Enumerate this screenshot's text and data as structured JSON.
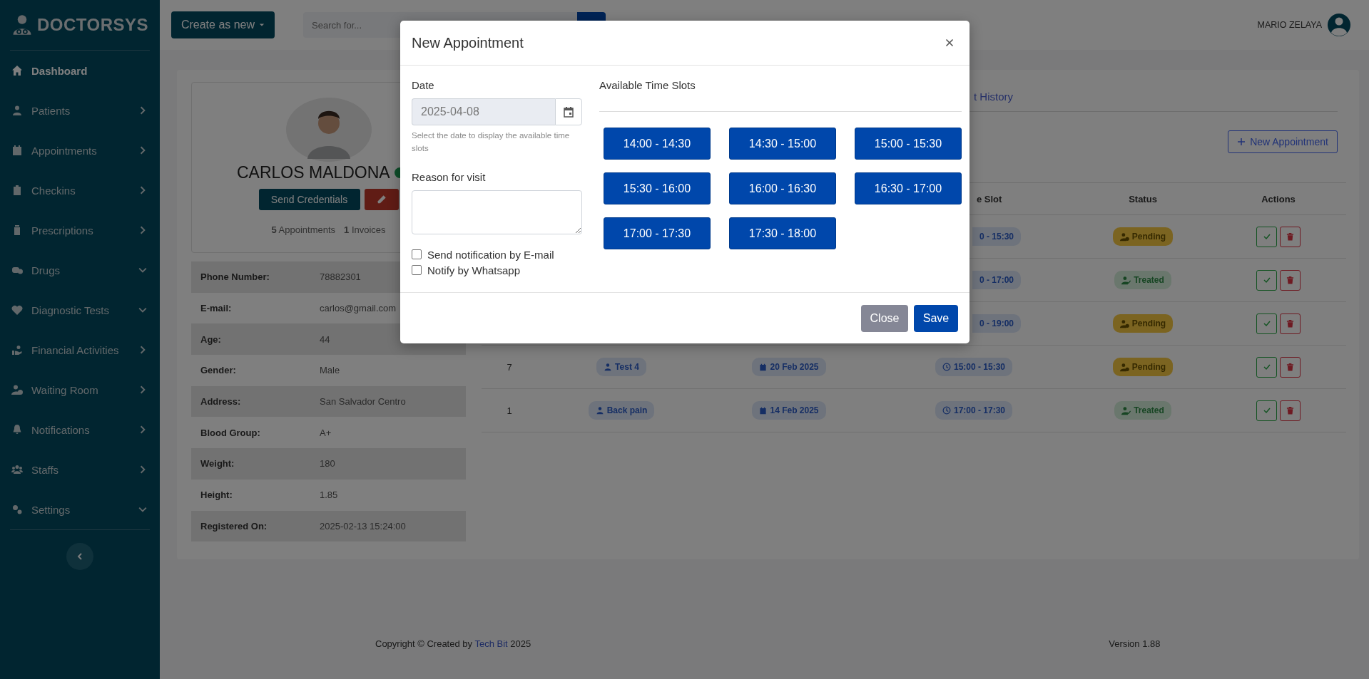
{
  "brand": "DOCTORSYS",
  "sidebar": {
    "items": [
      {
        "label": "Dashboard",
        "selected": true,
        "kind": "link"
      },
      {
        "label": "Patients",
        "selected": false,
        "kind": "submenu"
      },
      {
        "label": "Appointments",
        "selected": false,
        "kind": "submenu"
      },
      {
        "label": "Checkins",
        "selected": false,
        "kind": "submenu"
      },
      {
        "label": "Prescriptions",
        "selected": false,
        "kind": "submenu"
      },
      {
        "label": "Drugs",
        "selected": false,
        "kind": "dropdown"
      },
      {
        "label": "Diagnostic Tests",
        "selected": false,
        "kind": "dropdown"
      },
      {
        "label": "Financial Activities",
        "selected": false,
        "kind": "submenu"
      },
      {
        "label": "Waiting Room",
        "selected": false,
        "kind": "submenu"
      },
      {
        "label": "Notifications",
        "selected": false,
        "kind": "submenu"
      },
      {
        "label": "Staffs",
        "selected": false,
        "kind": "submenu"
      },
      {
        "label": "Settings",
        "selected": false,
        "kind": "dropdown"
      }
    ]
  },
  "topbar": {
    "create_button": "Create as new",
    "search": {
      "placeholder": "Search for..."
    },
    "user_name": "MARIO ZELAYA"
  },
  "patient": {
    "name": "CARLOS MALDONA",
    "online": true,
    "send_button": "Send Credentials",
    "appointments": "**5** Appointments",
    "invoices": "**1** Invoices",
    "details": [
      {
        "label": "Phone Number:",
        "value": "78882301"
      },
      {
        "label": "E-mail:",
        "value": "carlos@gmail.com"
      },
      {
        "label": "Age:",
        "value": "44"
      },
      {
        "label": "Gender:",
        "value": "Male"
      },
      {
        "label": "Address:",
        "value": "San Salvador Centro"
      },
      {
        "label": "Blood Group:",
        "value": "A+"
      },
      {
        "label": "Weight:",
        "value": "180"
      },
      {
        "label": "Height:",
        "value": "1.85"
      },
      {
        "label": "Registered On:",
        "value": "2025-02-13 15:24:00"
      }
    ]
  },
  "history": {
    "tab": "t History",
    "new_button": "New Appointment",
    "columns": [
      "e Slot",
      "Status",
      "Actions"
    ],
    "rows": [
      {
        "time": "0 - 15:30",
        "status": {
          "kind": "pending",
          "label": "Pending"
        }
      },
      {
        "time": "0 - 17:00",
        "status": {
          "kind": "treated",
          "label": "Treated"
        }
      },
      {
        "time": "0 - 19:00",
        "status": {
          "kind": "pending",
          "label": "Pending"
        }
      },
      {
        "number": "7",
        "reason": "Test 4",
        "date": "20 Feb 2025",
        "time": "15:00 - 15:30",
        "status": {
          "kind": "pending",
          "label": "Pending"
        }
      },
      {
        "number": "1",
        "reason": "Back pain",
        "date": "14 Feb 2025",
        "time": "17:00 - 17:30",
        "status": {
          "kind": "treated",
          "label": "Treated"
        }
      }
    ]
  },
  "modal": {
    "title": "New Appointment",
    "date_label": "Date",
    "date_value": "2025-04-08",
    "date_help": "Select the date to display the available time slots",
    "reason_label": "Reason for visit",
    "checkboxes": [
      {
        "label": "Send notification by E-mail",
        "checked": false
      },
      {
        "label": "Notify by Whatsapp",
        "checked": false
      }
    ],
    "slots_title": "Available Time Slots",
    "slots": [
      {
        "label": "14:00 - 14:30",
        "selected": false
      },
      {
        "label": "14:30 - 15:00",
        "selected": false
      },
      {
        "label": "15:00 - 15:30",
        "selected": false
      },
      {
        "label": "15:30 - 16:00",
        "selected": false
      },
      {
        "label": "16:00 - 16:30",
        "selected": false
      },
      {
        "label": "16:30 - 17:00",
        "selected": false
      },
      {
        "label": "17:00 - 17:30",
        "selected": false
      },
      {
        "label": "17:30 - 18:00",
        "selected": false
      }
    ],
    "close_button": "Close",
    "save_button": "Save"
  },
  "footer": {
    "copyright": "Copyright © Created by",
    "link": "Tech Bit",
    "year": "2025",
    "version": "Version 1.88"
  }
}
